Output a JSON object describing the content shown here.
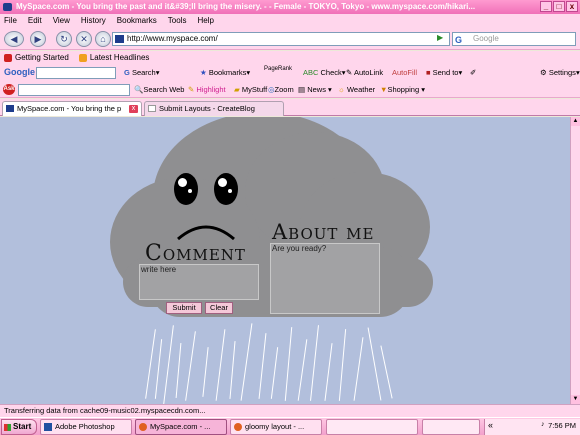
{
  "window": {
    "title": "MySpace.com - You bring the past and it&#39;ll bring the misery. - - Female - TOKYO, Tokyo - www.myspace.com/hikari...",
    "controls": [
      "_",
      "□",
      "x"
    ]
  },
  "menu": [
    "File",
    "Edit",
    "View",
    "History",
    "Bookmarks",
    "Tools",
    "Help"
  ],
  "nav": {
    "url": "http://www.myspace.com/",
    "search_placeholder": "Google"
  },
  "bookmarks": [
    "Getting Started",
    "Latest Headlines"
  ],
  "google_toolbar": {
    "brand": "Google",
    "search": "Search",
    "bookmarks": "Bookmarks",
    "pagerank": "PageRank",
    "check": "Check",
    "autolink": "AutoLink",
    "autofill": "AutoFill",
    "sendto": "Send to",
    "settings": "Settings"
  },
  "ask_toolbar": {
    "brand": "Ask",
    "search_web": "Search Web",
    "highlight": "Highlight",
    "mystuff": "MyStuff",
    "zoom": "Zoom",
    "news": "News",
    "weather": "Weather",
    "shopping": "Shopping"
  },
  "tabs": [
    {
      "label": "MySpace.com - You bring the p"
    },
    {
      "label": "Submit Layouts - CreateBlog"
    }
  ],
  "page": {
    "comment_heading": "Comment",
    "comment_placeholder": "write here",
    "about_heading": "About me",
    "about_text": "Are you ready?",
    "submit_label": "Submit",
    "clear_label": "Clear"
  },
  "status": "Transferring data from cache09-music02.myspacecdn.com...",
  "taskbar": {
    "start": "Start",
    "tasks": [
      "Adobe Photoshop",
      "MySpace.com - ...",
      "gloomy layout - ..."
    ],
    "tray_chevron": "«",
    "clock": "7:56 PM"
  },
  "colors": {
    "chrome_pink": "#ffd6ec",
    "page_background": "#b2bfdc",
    "cloud": "#8f8f91"
  }
}
